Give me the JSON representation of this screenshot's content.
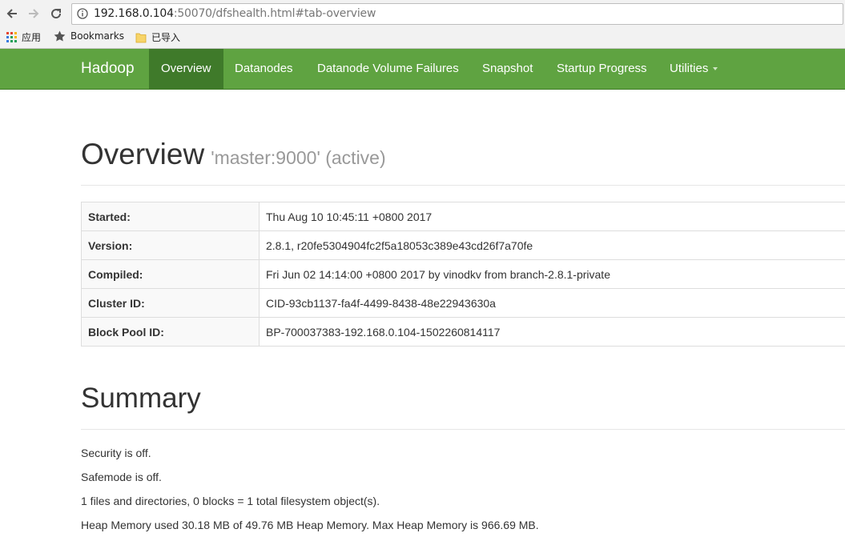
{
  "browser": {
    "url_host": "192.168.0.104",
    "url_rest": ":50070/dfshealth.html#tab-overview",
    "bookmarks": [
      {
        "label": "应用",
        "icon": "apps-grid-icon"
      },
      {
        "label": "Bookmarks",
        "icon": "star-icon"
      },
      {
        "label": "已导入",
        "icon": "folder-icon"
      }
    ]
  },
  "navbar": {
    "brand": "Hadoop",
    "items": [
      {
        "label": "Overview",
        "active": true
      },
      {
        "label": "Datanodes"
      },
      {
        "label": "Datanode Volume Failures"
      },
      {
        "label": "Snapshot"
      },
      {
        "label": "Startup Progress"
      },
      {
        "label": "Utilities",
        "dropdown": true
      }
    ]
  },
  "overview": {
    "title": "Overview",
    "subtitle": "'master:9000' (active)",
    "rows": [
      {
        "key": "Started:",
        "value": "Thu Aug 10 10:45:11 +0800 2017"
      },
      {
        "key": "Version:",
        "value": "2.8.1, r20fe5304904fc2f5a18053c389e43cd26f7a70fe"
      },
      {
        "key": "Compiled:",
        "value": "Fri Jun 02 14:14:00 +0800 2017 by vinodkv from branch-2.8.1-private"
      },
      {
        "key": "Cluster ID:",
        "value": "CID-93cb1137-fa4f-4499-8438-48e22943630a"
      },
      {
        "key": "Block Pool ID:",
        "value": "BP-700037383-192.168.0.104-1502260814117"
      }
    ]
  },
  "summary": {
    "title": "Summary",
    "lines": [
      "Security is off.",
      "Safemode is off.",
      "1 files and directories, 0 blocks = 1 total filesystem object(s).",
      "Heap Memory used 30.18 MB of 49.76 MB Heap Memory. Max Heap Memory is 966.69 MB."
    ]
  },
  "colors": {
    "navbar_bg": "#5fa341",
    "navbar_active": "#3f7a2a"
  }
}
